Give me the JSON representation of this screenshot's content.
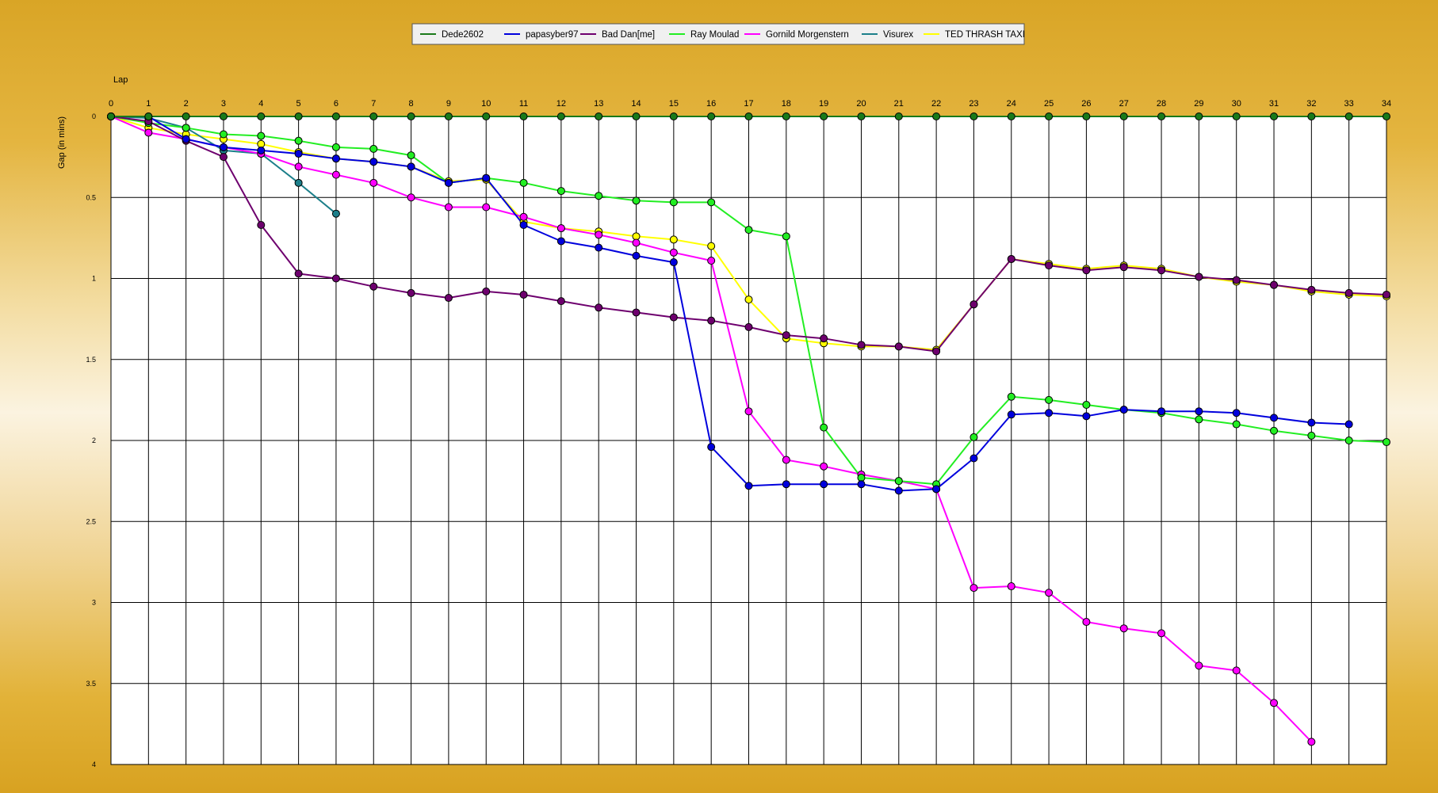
{
  "chart_data": {
    "type": "line",
    "xlabel": "Lap",
    "ylabel": "Gap (in mins)",
    "x_axis_position": "top",
    "y_inverted": true,
    "xlim": [
      0,
      34
    ],
    "ylim": [
      0,
      4
    ],
    "x_ticks": [
      0,
      1,
      2,
      3,
      4,
      5,
      6,
      7,
      8,
      9,
      10,
      11,
      12,
      13,
      14,
      15,
      16,
      17,
      18,
      19,
      20,
      21,
      22,
      23,
      24,
      25,
      26,
      27,
      28,
      29,
      30,
      31,
      32,
      33,
      34
    ],
    "y_ticks": [
      0,
      0.5,
      1,
      1.5,
      2,
      2.5,
      3,
      3.5,
      4
    ],
    "y_tick_labels": [
      "0",
      "0.5",
      "1",
      "1.5",
      "2",
      "2.5",
      "3",
      "3.5",
      "4"
    ],
    "grid": true,
    "legend_position": "top-center",
    "series": [
      {
        "name": "Dede2602",
        "color": "#1a7a1a",
        "values": [
          0,
          0,
          0,
          0,
          0,
          0,
          0,
          0,
          0,
          0,
          0,
          0,
          0,
          0,
          0,
          0,
          0,
          0,
          0,
          0,
          0,
          0,
          0,
          0,
          0,
          0,
          0,
          0,
          0,
          0,
          0,
          0,
          0,
          0,
          0
        ]
      },
      {
        "name": "papasyber97",
        "color": "#0000dd",
        "values": [
          0,
          0,
          0.14,
          0.19,
          0.21,
          0.23,
          0.26,
          0.28,
          0.31,
          0.41,
          0.38,
          0.67,
          0.77,
          0.81,
          0.86,
          0.9,
          2.04,
          2.28,
          2.27,
          2.27,
          2.27,
          2.31,
          2.3,
          2.11,
          1.84,
          1.83,
          1.85,
          1.81,
          1.82,
          1.82,
          1.83,
          1.86,
          1.89,
          1.9,
          null
        ]
      },
      {
        "name": "Bad Dan[me]",
        "color": "#6e006e",
        "values": [
          0,
          0.03,
          0.15,
          0.25,
          0.67,
          0.97,
          1.0,
          1.05,
          1.09,
          1.12,
          1.08,
          1.1,
          1.14,
          1.18,
          1.21,
          1.24,
          1.26,
          1.3,
          1.35,
          1.37,
          1.41,
          1.42,
          1.45,
          1.16,
          0.88,
          0.92,
          0.95,
          0.93,
          0.95,
          0.99,
          1.01,
          1.04,
          1.07,
          1.09,
          1.1
        ]
      },
      {
        "name": "Ray Moulad",
        "color": "#22ee22",
        "values": [
          0,
          0.04,
          0.07,
          0.11,
          0.12,
          0.15,
          0.19,
          0.2,
          0.24,
          0.41,
          0.38,
          0.41,
          0.46,
          0.49,
          0.52,
          0.53,
          0.53,
          0.7,
          0.74,
          1.92,
          2.23,
          2.25,
          2.27,
          1.98,
          1.73,
          1.75,
          1.78,
          1.81,
          1.83,
          1.87,
          1.9,
          1.94,
          1.97,
          2.0,
          2.01
        ]
      },
      {
        "name": "Gornild Morgenstern",
        "color": "#ff00ff",
        "values": [
          0,
          0.1,
          0.14,
          0.19,
          0.23,
          0.31,
          0.36,
          0.41,
          0.5,
          0.56,
          0.56,
          0.62,
          0.69,
          0.73,
          0.78,
          0.84,
          0.89,
          1.82,
          2.12,
          2.16,
          2.21,
          2.25,
          2.3,
          2.91,
          2.9,
          2.94,
          3.12,
          3.16,
          3.19,
          3.39,
          3.42,
          3.62,
          3.86,
          null,
          null
        ]
      },
      {
        "name": "Visurex",
        "color": "#1c7f8a",
        "values": [
          0,
          0.01,
          0.07,
          0.21,
          0.23,
          0.41,
          0.6,
          null,
          null,
          null,
          null,
          null,
          null,
          null,
          null,
          null,
          null,
          null,
          null,
          null,
          null,
          null,
          null,
          null,
          null,
          null,
          null,
          null,
          null,
          null,
          null,
          null,
          null,
          null,
          null
        ]
      },
      {
        "name": "TED THRASH TAXI",
        "color": "#ffff00",
        "values": [
          0,
          0.07,
          0.11,
          0.14,
          0.17,
          0.22,
          0.26,
          0.28,
          0.31,
          0.4,
          0.39,
          0.65,
          0.69,
          0.71,
          0.74,
          0.76,
          0.8,
          1.13,
          1.37,
          1.4,
          1.42,
          1.42,
          1.44,
          1.16,
          0.88,
          0.91,
          0.94,
          0.92,
          0.94,
          0.99,
          1.02,
          1.04,
          1.08,
          1.1,
          1.11
        ]
      }
    ]
  }
}
